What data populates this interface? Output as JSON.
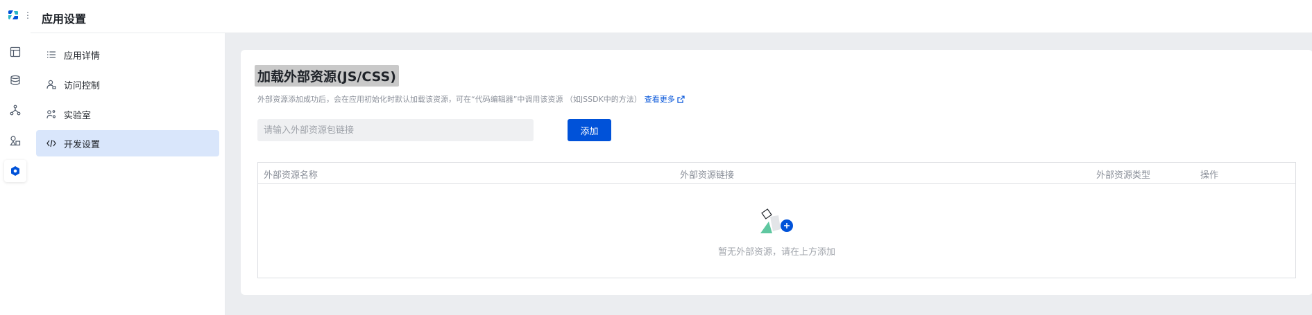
{
  "header": {
    "title": "应用设置"
  },
  "rail": {
    "icons": [
      "logo-icon",
      "more-dots-icon",
      "layout-icon",
      "database-icon",
      "workflow-icon",
      "components-icon",
      "settings-hex-icon"
    ],
    "dots": "⋮"
  },
  "nav": {
    "items": [
      {
        "label": "应用详情",
        "icon": "list-icon"
      },
      {
        "label": "访问控制",
        "icon": "user-lock-icon"
      },
      {
        "label": "实验室",
        "icon": "lab-icon"
      },
      {
        "label": "开发设置",
        "icon": "code-icon",
        "selected": true
      }
    ]
  },
  "section": {
    "title": "加载外部资源(JS/CSS)",
    "description": "外部资源添加成功后，会在应用初始化时默认加载该资源，可在“代码编辑器”中调用该资源 （如JSSDK中的方法）",
    "more_link": "查看更多"
  },
  "resource_input": {
    "placeholder": "请输入外部资源包链接",
    "value": ""
  },
  "add_button": {
    "label": "添加"
  },
  "table": {
    "columns": [
      "外部资源名称",
      "外部资源链接",
      "外部资源类型",
      "操作"
    ],
    "rows": [],
    "empty_text": "暂无外部资源，请在上方添加"
  },
  "colors": {
    "primary": "#0052d9",
    "nav_selected_bg": "#d9e6fb",
    "main_bg": "#ebedf0",
    "empty_green": "#5fc7a0"
  }
}
